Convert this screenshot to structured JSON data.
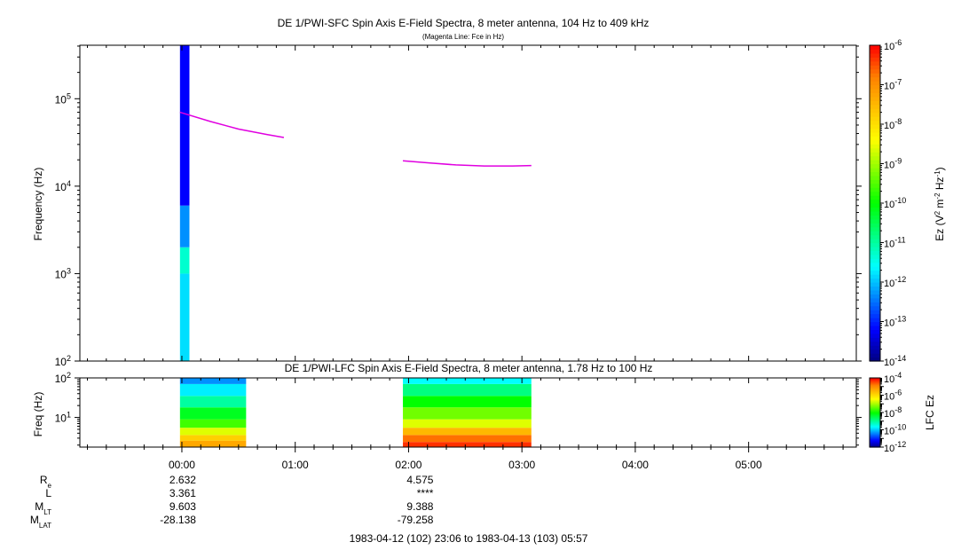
{
  "chart_data": [
    {
      "type": "heatmap",
      "title": "DE 1/PWI-SFC  Spin Axis E-Field Spectra, 8 meter antenna, 104 Hz to 409 kHz",
      "subtitle": "(Magenta Line: Fce in Hz)",
      "ylabel": "Frequency (Hz)",
      "yscale": "log",
      "ylim": [
        100,
        409000
      ],
      "yticks": [
        {
          "base": "10",
          "exp": "2",
          "value": 100
        },
        {
          "base": "10",
          "exp": "3",
          "value": 1000
        },
        {
          "base": "10",
          "exp": "4",
          "value": 10000
        },
        {
          "base": "10",
          "exp": "5",
          "value": 100000
        }
      ],
      "xlim": [
        "1983-04-12 23:06",
        "1983-04-13 05:57"
      ],
      "colorbar": {
        "label_prefix": "Ez (V",
        "label_sup1": "2",
        "label_mid1": " m",
        "label_sup2": "-2",
        "label_mid2": " Hz",
        "label_sup3": "-1",
        "label_suffix": ")",
        "scale": "log",
        "range": [
          1e-14,
          1e-06
        ],
        "ticks": [
          {
            "base": "10",
            "exp": "-6",
            "value": -6
          },
          {
            "base": "10",
            "exp": "-7",
            "value": -7
          },
          {
            "base": "10",
            "exp": "-8",
            "value": -8
          },
          {
            "base": "10",
            "exp": "-9",
            "value": -9
          },
          {
            "base": "10",
            "exp": "-10",
            "value": -10
          },
          {
            "base": "10",
            "exp": "-11",
            "value": -11
          },
          {
            "base": "10",
            "exp": "-12",
            "value": -12
          },
          {
            "base": "10",
            "exp": "-13",
            "value": -13
          },
          {
            "base": "10",
            "exp": "-14",
            "value": -14
          }
        ]
      },
      "spectrogram_blocks": [
        {
          "time_start": "23:59",
          "time_end": "00:04",
          "freq_low": 100,
          "freq_high": 409000,
          "log10_ez_by_band": [
            {
              "f_low": 100,
              "f_high": 1000,
              "value": -11.8
            },
            {
              "f_low": 1000,
              "f_high": 2000,
              "value": -11.3
            },
            {
              "f_low": 2000,
              "f_high": 6000,
              "value": -12.3
            },
            {
              "f_low": 6000,
              "f_high": 409000,
              "value": -13.2
            }
          ]
        }
      ],
      "fce_line": {
        "color": "#e000e0",
        "segments": [
          {
            "x": [
              "23:59",
              "00:15",
              "00:30",
              "00:45",
              "00:54"
            ],
            "y": [
              70000,
              55000,
              45000,
              39000,
              36000
            ]
          },
          {
            "x": [
              "01:57",
              "02:10",
              "02:25",
              "02:40",
              "02:55",
              "03:05"
            ],
            "y": [
              19500,
              18500,
              17500,
              17000,
              17000,
              17200
            ]
          }
        ]
      }
    },
    {
      "type": "heatmap",
      "title": "DE 1/PWI-LFC  Spin Axis E-Field Spectra, 8 meter antenna, 1.78 Hz to 100 Hz",
      "ylabel": "Freq (Hz)",
      "yscale": "log",
      "ylim": [
        1.78,
        100
      ],
      "yticks": [
        {
          "base": "10",
          "exp": "1",
          "value": 10
        },
        {
          "base": "10",
          "exp": "2",
          "value": 100
        }
      ],
      "colorbar": {
        "label": "LFC Ez",
        "scale": "log",
        "range": [
          1e-12,
          0.0001
        ],
        "ticks": [
          {
            "base": "10",
            "exp": "-4",
            "value": -4
          },
          {
            "base": "10",
            "exp": "-6",
            "value": -6
          },
          {
            "base": "10",
            "exp": "-8",
            "value": -8
          },
          {
            "base": "10",
            "exp": "-10",
            "value": -10
          },
          {
            "base": "10",
            "exp": "-12",
            "value": -12
          }
        ]
      },
      "spectrogram_blocks": [
        {
          "time_start": "23:59",
          "time_end": "00:34",
          "log10_ez_by_band": [
            {
              "f_low": 1.78,
              "f_high": 2.6,
              "value": -5.3
            },
            {
              "f_low": 2.6,
              "f_high": 3.6,
              "value": -5.8
            },
            {
              "f_low": 3.6,
              "f_high": 5.5,
              "value": -6.6
            },
            {
              "f_low": 5.5,
              "f_high": 9,
              "value": -7.6
            },
            {
              "f_low": 9,
              "f_high": 18,
              "value": -8.2
            },
            {
              "f_low": 18,
              "f_high": 35,
              "value": -9.0
            },
            {
              "f_low": 35,
              "f_high": 70,
              "value": -9.7
            },
            {
              "f_low": 70,
              "f_high": 100,
              "value": -10.3
            }
          ]
        },
        {
          "time_start": "01:57",
          "time_end": "03:05",
          "log10_ez_by_band": [
            {
              "f_low": 1.78,
              "f_high": 2.4,
              "value": -4.3
            },
            {
              "f_low": 2.4,
              "f_high": 3.6,
              "value": -4.7
            },
            {
              "f_low": 3.6,
              "f_high": 5.5,
              "value": -5.5
            },
            {
              "f_low": 5.5,
              "f_high": 9,
              "value": -6.6
            },
            {
              "f_low": 9,
              "f_high": 18,
              "value": -7.3
            },
            {
              "f_low": 18,
              "f_high": 35,
              "value": -8.0
            },
            {
              "f_low": 35,
              "f_high": 70,
              "value": -8.8
            },
            {
              "f_low": 70,
              "f_high": 100,
              "value": -9.6
            }
          ]
        }
      ]
    }
  ],
  "time_axis": {
    "ticks": [
      "00:00",
      "01:00",
      "02:00",
      "03:00",
      "04:00",
      "05:00"
    ],
    "range_label": "1983-04-12 (102) 23:06 to 1983-04-13 (103) 05:57"
  },
  "ephemeris": {
    "rows": [
      {
        "label": "R",
        "sub": "e",
        "values": [
          "2.632",
          "4.575"
        ]
      },
      {
        "label": "L",
        "sub": "",
        "values": [
          "3.361",
          "****"
        ]
      },
      {
        "label": "M",
        "sub": "LT",
        "values": [
          "9.603",
          "9.388"
        ]
      },
      {
        "label": "M",
        "sub": "LAT",
        "values": [
          "-28.138",
          "-79.258"
        ]
      }
    ]
  },
  "colors": {
    "fce_line": "#e000e0",
    "colormap": [
      "#000080",
      "#0000ff",
      "#0080ff",
      "#00ffff",
      "#00ff80",
      "#00ff00",
      "#80ff00",
      "#ffff00",
      "#ffc000",
      "#ff8000",
      "#ff0000"
    ]
  }
}
